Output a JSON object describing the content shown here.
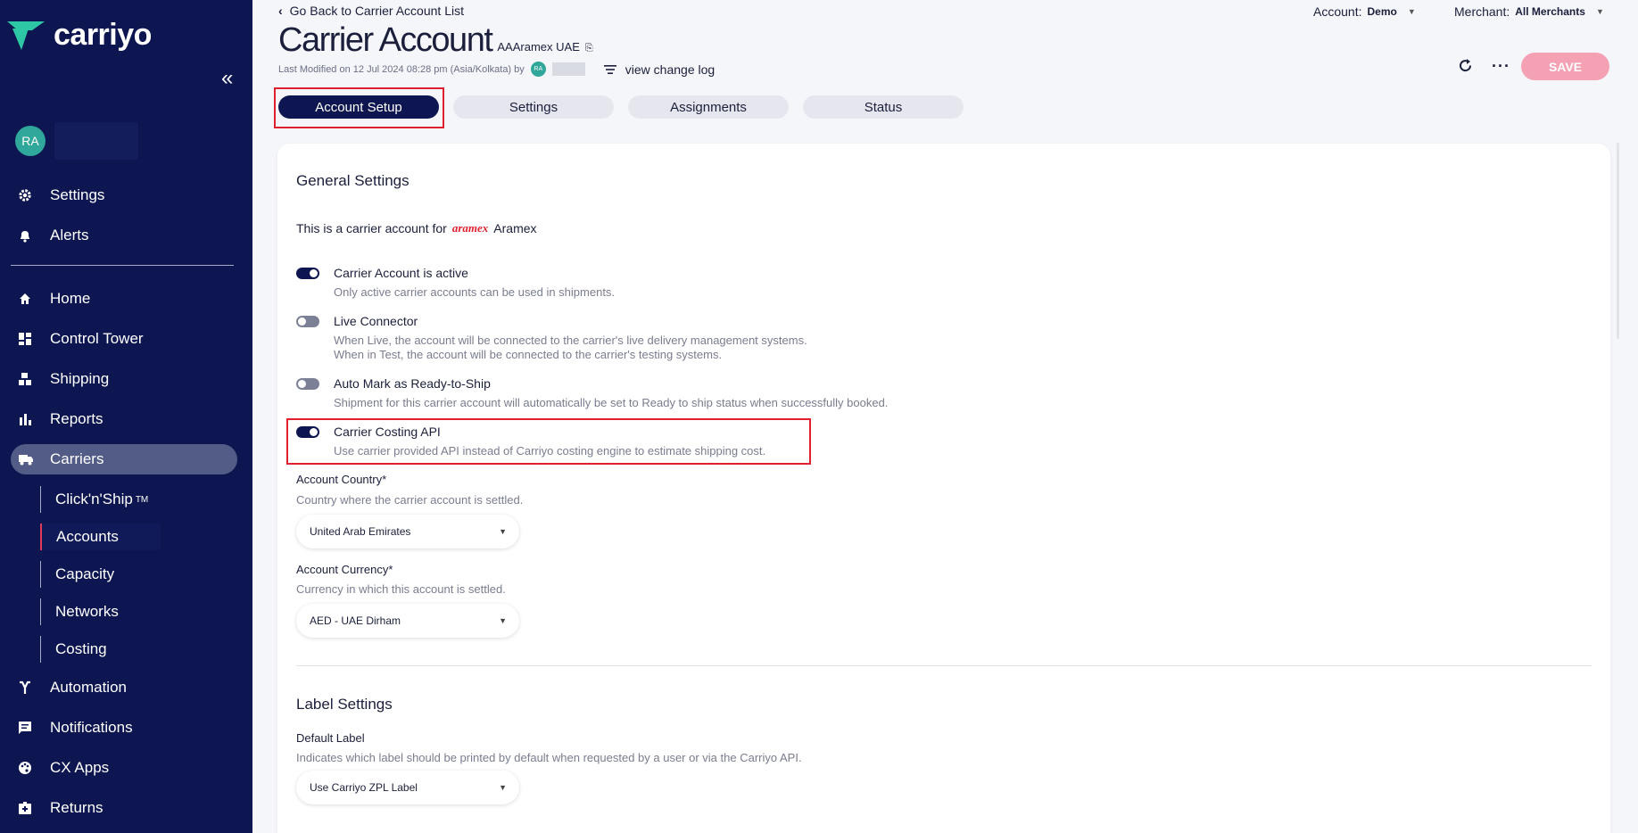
{
  "sidebar": {
    "logo": "carriyo",
    "user_initials": "RA",
    "top_items": [
      {
        "label": "Settings",
        "icon": "gear-icon"
      },
      {
        "label": "Alerts",
        "icon": "bell-icon"
      }
    ],
    "items": [
      {
        "label": "Home",
        "icon": "home-icon"
      },
      {
        "label": "Control Tower",
        "icon": "dashboard-icon"
      },
      {
        "label": "Shipping",
        "icon": "boxes-icon"
      },
      {
        "label": "Reports",
        "icon": "bar-chart-icon"
      },
      {
        "label": "Carriers",
        "icon": "truck-icon"
      }
    ],
    "carrier_subitems": [
      "Click'n'Ship",
      "Accounts",
      "Capacity",
      "Networks",
      "Costing"
    ],
    "clicknship_trademark": "TM",
    "bottom_items": [
      {
        "label": "Automation",
        "icon": "automation-icon"
      },
      {
        "label": "Notifications",
        "icon": "chat-icon"
      },
      {
        "label": "CX Apps",
        "icon": "palette-icon"
      },
      {
        "label": "Returns",
        "icon": "returns-icon"
      }
    ]
  },
  "header": {
    "back_link": "Go Back to Carrier Account List",
    "title": "Carrier Account",
    "subtitle": "AAAramex UAE",
    "last_modified": "Last Modified on 12 Jul 2024 08:28 pm (Asia/Kolkata) by",
    "modifier_initials": "RA",
    "change_log": "view change log",
    "account_label": "Account:",
    "account_value": "Demo",
    "merchant_label": "Merchant:",
    "merchant_value": "All Merchants",
    "save_label": "SAVE"
  },
  "tabs": [
    "Account Setup",
    "Settings",
    "Assignments",
    "Status"
  ],
  "general": {
    "title": "General Settings",
    "carrier_intro": "This is a carrier account for",
    "carrier_logo": "aramex",
    "carrier_name": "Aramex",
    "toggles": [
      {
        "label": "Carrier Account is active",
        "help": "Only active carrier accounts can be used in shipments.",
        "on": true
      },
      {
        "label": "Live Connector",
        "help": "When Live, the account will be connected to the carrier's live delivery management systems.",
        "help2": "When in Test, the account will be connected to the carrier's testing systems.",
        "on": false
      },
      {
        "label": "Auto Mark as Ready-to-Ship",
        "help": "Shipment for this carrier account will automatically be set to Ready to ship status when successfully booked.",
        "on": false
      },
      {
        "label": "Carrier Costing API",
        "help": "Use carrier provided API instead of Carriyo costing engine to estimate shipping cost.",
        "on": true
      }
    ],
    "country_label": "Account Country*",
    "country_help": "Country where the carrier account is settled.",
    "country_value": "United Arab Emirates",
    "currency_label": "Account Currency*",
    "currency_help": "Currency in which this account is settled.",
    "currency_value": "AED - UAE Dirham"
  },
  "label_settings": {
    "title": "Label Settings",
    "default_label": "Default Label",
    "default_help": "Indicates which label should be printed by default when requested by a user or via the Carriyo API.",
    "default_value": "Use Carriyo ZPL Label"
  },
  "colors": {
    "sidebar": "#0d1650",
    "accent_red": "#e0202f",
    "save_button": "#f4a2b3",
    "avatar": "#2fa79a"
  }
}
